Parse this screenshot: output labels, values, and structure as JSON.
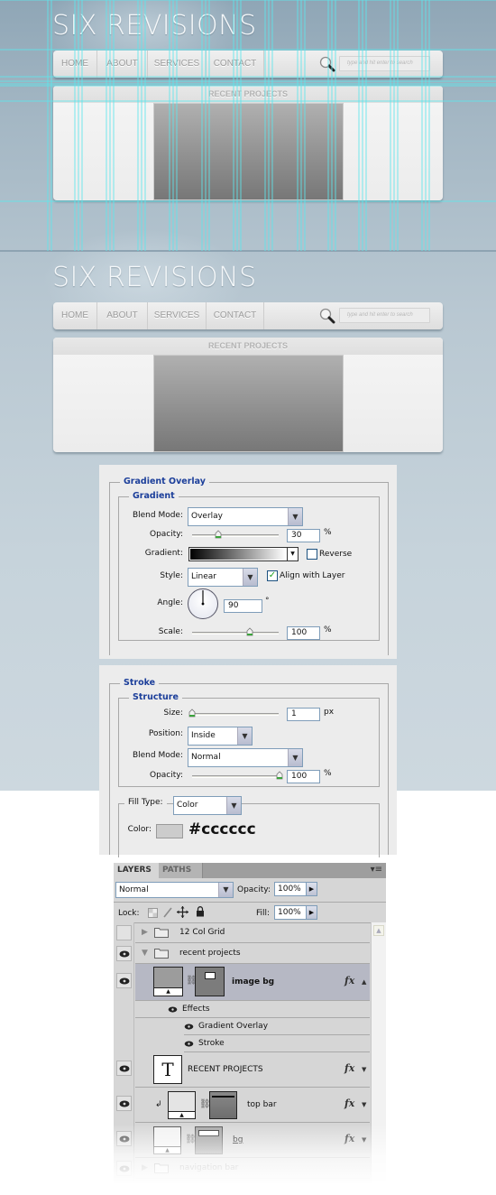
{
  "mockup": {
    "logo": "SIX REVISIONS",
    "nav": [
      "HOME",
      "ABOUT",
      "SERVICES",
      "CONTACT"
    ],
    "search_placeholder": "type and hit enter to search",
    "section_title": "RECENT PROJECTS",
    "guides_visible": true
  },
  "gradient_overlay": {
    "title": "Gradient Overlay",
    "group": "Gradient",
    "blend_mode_label": "Blend Mode:",
    "blend_mode": "Overlay",
    "opacity_label": "Opacity:",
    "opacity": "30",
    "opacity_unit": "%",
    "opacity_fraction": 0.3,
    "gradient_label": "Gradient:",
    "gradient_colors": [
      "#000000",
      "#ffffff"
    ],
    "reverse_label": "Reverse",
    "reverse_checked": false,
    "style_label": "Style:",
    "style": "Linear",
    "align_label": "Align with Layer",
    "align_checked": true,
    "angle_label": "Angle:",
    "angle": "90",
    "angle_unit": "°",
    "scale_label": "Scale:",
    "scale": "100",
    "scale_unit": "%",
    "scale_fraction": 0.67
  },
  "stroke": {
    "title": "Stroke",
    "group": "Structure",
    "size_label": "Size:",
    "size": "1",
    "size_unit": "px",
    "position_label": "Position:",
    "position": "Inside",
    "blend_mode_label": "Blend Mode:",
    "blend_mode": "Normal",
    "opacity_label": "Opacity:",
    "opacity": "100",
    "opacity_unit": "%",
    "fill_type_label": "Fill Type:",
    "fill_type": "Color",
    "color_label": "Color:",
    "color_value": "#cccccc",
    "color_hex_text": "#cccccc"
  },
  "layers_panel": {
    "tabs": [
      "LAYERS",
      "PATHS"
    ],
    "blend_mode": "Normal",
    "opacity_label": "Opacity:",
    "opacity": "100%",
    "lock_label": "Lock:",
    "fill_label": "Fill:",
    "fill": "100%",
    "layers": [
      {
        "name": "12 Col Grid",
        "type": "group",
        "visible": false,
        "expanded": false
      },
      {
        "name": "recent projects",
        "type": "group",
        "visible": true,
        "expanded": true
      },
      {
        "name": "image bg",
        "type": "shape",
        "visible": true,
        "selected": true,
        "fx": "fx"
      },
      {
        "name": "Effects",
        "type": "effects-header"
      },
      {
        "name": "Gradient Overlay",
        "type": "effect"
      },
      {
        "name": "Stroke",
        "type": "effect"
      },
      {
        "name": "RECENT PROJECTS",
        "type": "text",
        "visible": true,
        "thumb_glyph": "T",
        "fx": "fx"
      },
      {
        "name": "top bar",
        "type": "shape",
        "visible": true,
        "clipped": true,
        "fx": "fx"
      },
      {
        "name": "bg",
        "type": "shape",
        "visible": true,
        "fx": "fx"
      },
      {
        "name": "navigation bar",
        "type": "group",
        "visible": true,
        "expanded": false
      }
    ]
  }
}
